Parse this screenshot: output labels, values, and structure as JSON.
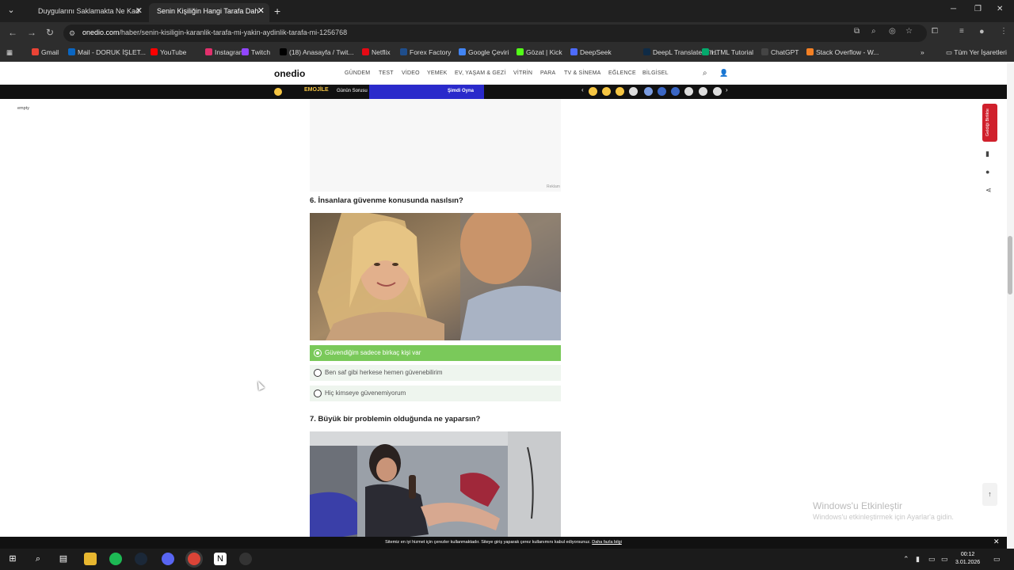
{
  "browser": {
    "tabs": [
      {
        "label": "Duygularını Saklamakta Ne Kad",
        "close": "✕"
      },
      {
        "label": "Senin Kişiliğin Hangi Tarafa Dah",
        "close": "✕"
      }
    ],
    "new_tab": "+",
    "url_host": "onedio.com",
    "url_path": "/haber/senin-kisiligin-karanlik-tarafa-mi-yakin-aydinlik-tarafa-mi-1256768",
    "bookmarks": [
      {
        "label": "Gmail",
        "color": "#ea4335"
      },
      {
        "label": "Mail - DORUK İŞLET...",
        "color": "#0a66c2"
      },
      {
        "label": "YouTube",
        "color": "#ff0000"
      },
      {
        "label": "Instagram",
        "color": "#e1306c"
      },
      {
        "label": "Twitch",
        "color": "#9146ff"
      },
      {
        "label": "(18) Anasayfa / Twit...",
        "color": "#000000"
      },
      {
        "label": "Netflix",
        "color": "#e50914"
      },
      {
        "label": "Forex Factory",
        "color": "#1f4e8c"
      },
      {
        "label": "Google Çeviri",
        "color": "#4285f4"
      },
      {
        "label": "Gözat | Kick",
        "color": "#53fc18"
      },
      {
        "label": "DeepSeek",
        "color": "#4d6bfe"
      },
      {
        "label": "DeepL Translate: Th...",
        "color": "#0f2b46"
      },
      {
        "label": "HTML Tutorial",
        "color": "#04aa6d"
      },
      {
        "label": "ChatGPT",
        "color": "#444444"
      },
      {
        "label": "Stack Overflow - W...",
        "color": "#f48024"
      }
    ],
    "all_bookmarks": "Tüm Yer İşaretleri"
  },
  "site": {
    "logo": "onedio",
    "nav": [
      "GÜNDEM",
      "TEST",
      "VİDEO",
      "YEMEK",
      "EV, YAŞAM & GEZİ",
      "VİTRİN",
      "PARA",
      "TV & SİNEMA",
      "EĞLENCE",
      "BİLGİSEL"
    ],
    "strip": {
      "game": "EMOJİLE",
      "daily": "Günün Sorusu",
      "play": "Şimdi Oyna"
    }
  },
  "page": {
    "empty_label": "empty",
    "ad_label": "Reklam",
    "q6": {
      "title": "6. İnsanlara güvenme konusunda nasılsın?",
      "options": [
        "Güvendiğim sadece birkaç kişi var",
        "Ben saf gibi herkese hemen güvenebilirim",
        "Hiç kimseye güvenemiyorum"
      ],
      "selected_index": 0
    },
    "q7": {
      "title": "7. Büyük bir problemin olduğunda ne yaparsın?"
    },
    "side_button": "Geldiği Birlikte",
    "cookie_text": "Sitemiz en iyi hizmet için çerezler kullanmaktadır. Siteye giriş yaparak çerez kullanımını kabul ediyorsunuz.",
    "cookie_link": "Daha fazla bilgi"
  },
  "windows": {
    "activate_title": "Windows'u Etkinleştir",
    "activate_sub": "Windows'u etkinleştirmek için Ayarlar'a gidin.",
    "time": "00:12",
    "date": "3.01.2026"
  }
}
